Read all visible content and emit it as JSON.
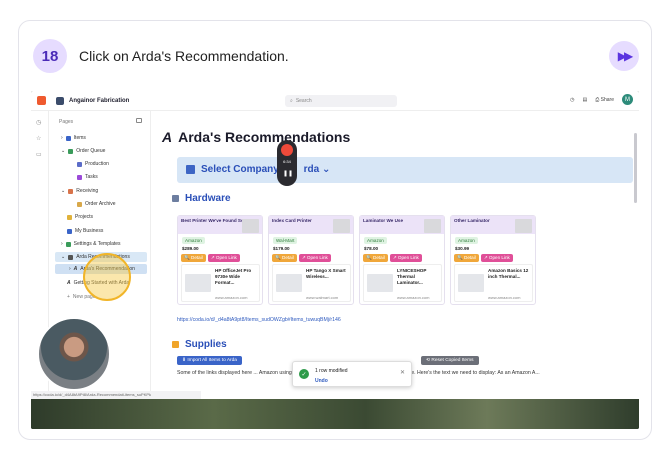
{
  "step": {
    "number": "18",
    "instruction": "Click on Arda's Recommendation."
  },
  "app": {
    "doc_title": "Angainor Fabrication",
    "search_placeholder": "Search",
    "share_label": "Share",
    "avatar_initial": "M"
  },
  "sidebar": {
    "header": "Pages",
    "items": [
      {
        "label": "Items",
        "color": "#3a64c8"
      },
      {
        "label": "Order Queue",
        "color": "#3a9b5a"
      },
      {
        "label": "Production",
        "color": "#5b6cc8"
      },
      {
        "label": "Tasks",
        "color": "#9b4ad8"
      },
      {
        "label": "Receiving",
        "color": "#d8734a"
      },
      {
        "label": "Order Archive",
        "color": "#d8a84a"
      },
      {
        "label": "Projects",
        "color": "#e0b23a"
      },
      {
        "label": "My Business",
        "color": "#3a64c8"
      },
      {
        "label": "Settings & Templates",
        "color": "#3a9b5a"
      },
      {
        "label": "Arda Recommendations",
        "color": "#555555"
      },
      {
        "label": "Arda's Recommendation",
        "color": "#555555"
      },
      {
        "label": "Getting Started with Arda",
        "color": "#555555"
      }
    ],
    "new_page": "New page"
  },
  "main": {
    "title": "Arda's Recommendations",
    "select_company": "Select Company",
    "select_company_suffix": "rda",
    "recorder_time": "6:34",
    "hardware_heading": "Hardware",
    "supplies_heading": "Supplies",
    "products": [
      {
        "header": "Best Printer We've Found So Far",
        "store": "Amazon",
        "price": "$289.00",
        "name": "HP OfficeJet Pro 9730e Wide Format...",
        "domain": "www.amazon.com"
      },
      {
        "header": "Index Card Printer",
        "store": "Wal-Mart",
        "price": "$179.00",
        "name": "HP Tango X Smart Wireless...",
        "domain": "www.walmart.com"
      },
      {
        "header": "Laminator We Use",
        "store": "Amazon",
        "price": "$78.00",
        "name": "LYNICESHOP Thermal Laminator...",
        "domain": "www.amazon.com"
      },
      {
        "header": "Other Laminator",
        "store": "Amazon",
        "price": "$30.99",
        "name": "Amazon Basics 12 inch Thermal...",
        "domain": "www.amazon.com"
      }
    ],
    "detail_label": "Detail",
    "open_link_label": "Open Link",
    "url": "https://coda.io/d/_d4a8tA9pt8/Items_sudOWZgb#Items_tuwuqBMj/r146",
    "import_button": "Import All Items to Arda",
    "reset_button": "Reset Copied Items",
    "body_text": "Some of the links displayed here ... Amazon using these links, we'll earn a commission on the purchase. Here's the text we need to display: As an Amazon A..."
  },
  "toast": {
    "message": "1 row modified",
    "action": "Undo"
  },
  "statusbar": {
    "url": "https://coda.io/d/_d4A8tA9Pt8/Arda-Recommendati-items_suPKPk"
  }
}
